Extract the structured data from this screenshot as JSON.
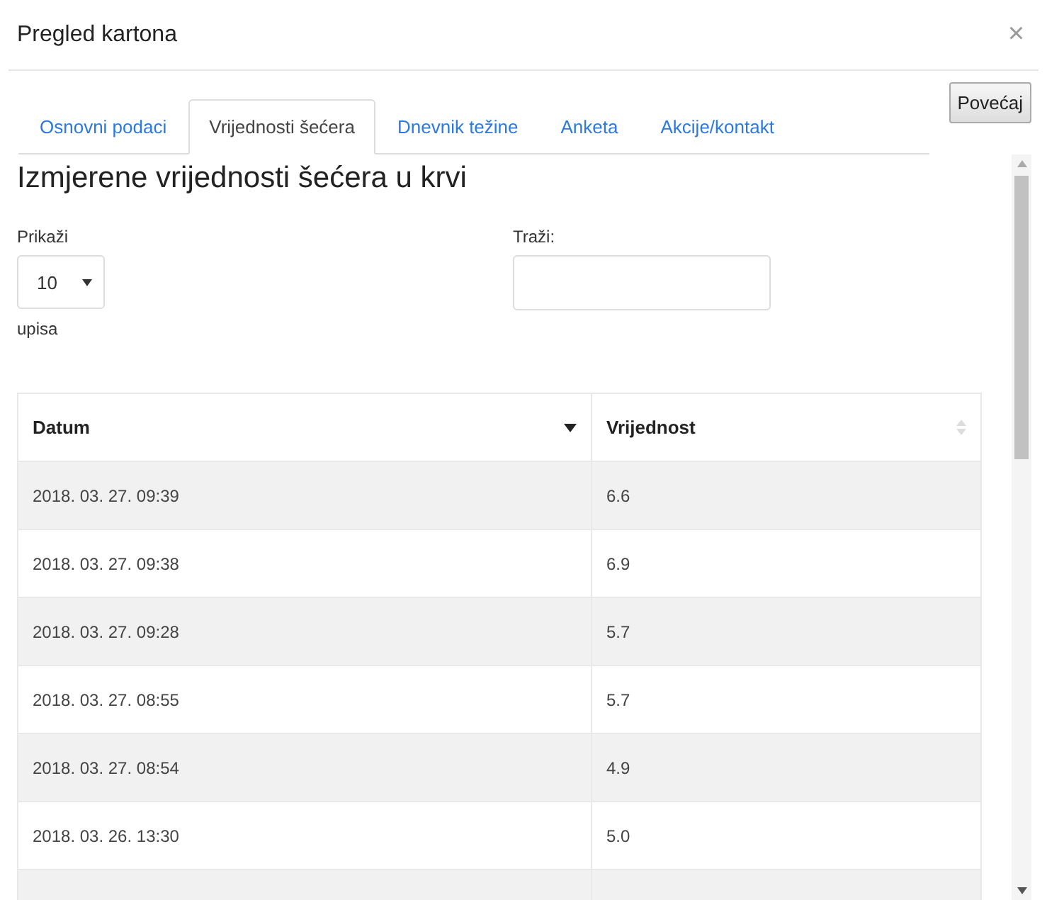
{
  "dialog": {
    "title": "Pregled kartona",
    "close": "×"
  },
  "tabs": [
    {
      "label": "Osnovni podaci",
      "selected": false
    },
    {
      "label": "Vrijednosti šećera",
      "selected": true
    },
    {
      "label": "Dnevnik težine",
      "selected": false
    },
    {
      "label": "Anketa",
      "selected": false
    },
    {
      "label": "Akcije/kontakt",
      "selected": false
    }
  ],
  "enlarge_button": "Povećaj",
  "heading": "Izmjerene vrijednosti šećera u krvi",
  "length": {
    "label_before": "Prikaži",
    "value": "10",
    "label_after": "upisa"
  },
  "search": {
    "label": "Traži:"
  },
  "table": {
    "columns": [
      {
        "label": "Datum",
        "sorted": true
      },
      {
        "label": "Vrijednost",
        "sorted": false
      }
    ],
    "rows": [
      [
        "2018. 03. 27. 09:39",
        "6.6"
      ],
      [
        "2018. 03. 27. 09:38",
        "6.9"
      ],
      [
        "2018. 03. 27. 09:28",
        "5.7"
      ],
      [
        "2018. 03. 27. 08:55",
        "5.7"
      ],
      [
        "2018. 03. 27. 08:54",
        "4.9"
      ],
      [
        "2018. 03. 26. 13:30",
        "5.0"
      ]
    ]
  }
}
